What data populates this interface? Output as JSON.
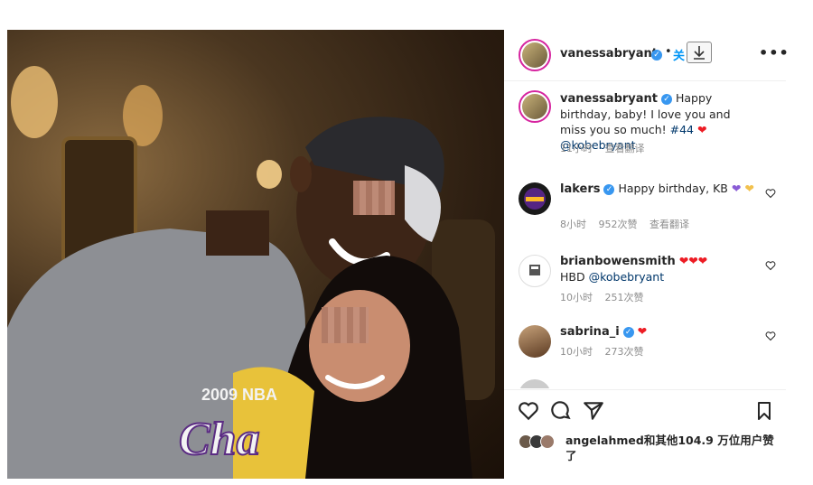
{
  "post": {
    "author": "vanessabryant",
    "dot": "•",
    "follow_label": "关",
    "more_label": "•••"
  },
  "photo": {
    "shirt_text_line1": "2009 NBA",
    "shirt_text_line2": "Cha"
  },
  "comments": [
    {
      "user": "vanessabryant",
      "text": "Happy birthday, baby! I love you and miss you so much!",
      "tag": "#44",
      "mention": "@kobebryant",
      "time": "11小时",
      "translate": "查看翻译"
    },
    {
      "user": "lakers",
      "text": "Happy birthday, KB",
      "time": "8小时",
      "likes": "952次赞",
      "translate": "查看翻译"
    },
    {
      "user": "brianbowensmith",
      "text": "HBD",
      "mention": "@kobebryant",
      "time": "10小时",
      "likes": "251次赞"
    },
    {
      "user": "sabrina_i",
      "time": "10小时",
      "likes": "273次赞"
    }
  ],
  "likes": {
    "text": "angelahmed和其他104.9 万位用户赞了"
  },
  "colors": {
    "verified": "#3897f0",
    "heart_red": "#ed1c24",
    "heart_purple": "#8a5cd6",
    "heart_gold": "#f2c14e",
    "link": "#00376b"
  }
}
